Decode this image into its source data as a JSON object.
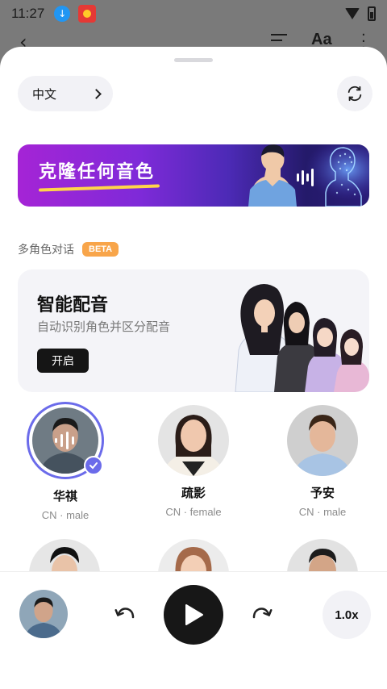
{
  "status_bar": {
    "time": "11:27"
  },
  "background_toolbar": {
    "font_button": "Aa"
  },
  "language": {
    "label": "中文"
  },
  "banner": {
    "title": "克隆任何音色"
  },
  "multi_role": {
    "label": "多角色对话",
    "badge": "BETA"
  },
  "smart_dub": {
    "title": "智能配音",
    "subtitle": "自动识别角色并区分配音",
    "button": "开启"
  },
  "voices": [
    {
      "name": "华祺",
      "meta": "CN · male",
      "selected": true
    },
    {
      "name": "疏影",
      "meta": "CN · female",
      "selected": false
    },
    {
      "name": "予安",
      "meta": "CN · male",
      "selected": false
    }
  ],
  "player": {
    "speed": "1.0x"
  },
  "colors": {
    "accent": "#6b6bea",
    "beta": "#f8a54a",
    "play": "#171717"
  }
}
